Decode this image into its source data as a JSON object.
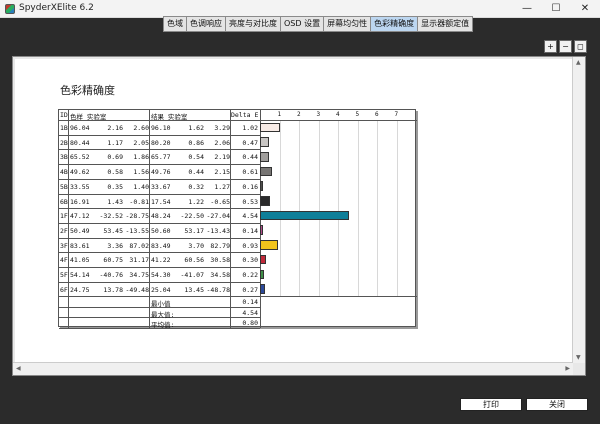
{
  "window": {
    "title": "SpyderXElite 6.2",
    "min": "—",
    "max": "☐",
    "close": "✕"
  },
  "tabs": [
    {
      "label": "色域",
      "active": false
    },
    {
      "label": "色调响应",
      "active": false
    },
    {
      "label": "亮度与对比度",
      "active": false
    },
    {
      "label": "OSD 设置",
      "active": false
    },
    {
      "label": "屏幕均匀性",
      "active": false
    },
    {
      "label": "色彩精确度",
      "active": true
    },
    {
      "label": "显示器额定值",
      "active": false
    }
  ],
  "zoom": {
    "zoom_in": "+",
    "zoom_out": "−",
    "zoom_fit": "◻"
  },
  "report": {
    "title": "色彩精确度",
    "headers": {
      "id": "ID",
      "ref": "色样 实验室",
      "res": "结果 实验室",
      "de": "Delta E"
    },
    "ticks": [
      "1",
      "2",
      "3",
      "4",
      "5",
      "6",
      "7"
    ],
    "rows": [
      {
        "id": "1B",
        "ref": [
          "96.04",
          "2.16",
          "2.60"
        ],
        "res": [
          "96.10",
          "1.62",
          "3.29"
        ],
        "de": "1.02",
        "de_value": 1.02,
        "color": "#f7ebe6"
      },
      {
        "id": "2B",
        "ref": [
          "80.44",
          "1.17",
          "2.05"
        ],
        "res": [
          "80.20",
          "0.86",
          "2.06"
        ],
        "de": "0.47",
        "de_value": 0.47,
        "color": "#c8c5c3"
      },
      {
        "id": "3B",
        "ref": [
          "65.52",
          "0.69",
          "1.86"
        ],
        "res": [
          "65.77",
          "0.54",
          "2.19"
        ],
        "de": "0.44",
        "de_value": 0.44,
        "color": "#a09e9c"
      },
      {
        "id": "4B",
        "ref": [
          "49.62",
          "0.58",
          "1.56"
        ],
        "res": [
          "49.76",
          "0.44",
          "2.15"
        ],
        "de": "0.61",
        "de_value": 0.61,
        "color": "#777573"
      },
      {
        "id": "5B",
        "ref": [
          "33.55",
          "0.35",
          "1.40"
        ],
        "res": [
          "33.67",
          "0.32",
          "1.27"
        ],
        "de": "0.16",
        "de_value": 0.16,
        "color": "#4f4e4d"
      },
      {
        "id": "6B",
        "ref": [
          "16.91",
          "1.43",
          "-0.81"
        ],
        "res": [
          "17.54",
          "1.22",
          "-0.65"
        ],
        "de": "0.53",
        "de_value": 0.53,
        "color": "#2a2a2b"
      },
      {
        "id": "1F",
        "ref": [
          "47.12",
          "-32.52",
          "-28.75"
        ],
        "res": [
          "48.24",
          "-22.50",
          "-27.04"
        ],
        "de": "4.54",
        "de_value": 4.54,
        "color": "#0f7f99"
      },
      {
        "id": "2F",
        "ref": [
          "50.49",
          "53.45",
          "-13.55"
        ],
        "res": [
          "50.60",
          "53.17",
          "-13.43"
        ],
        "de": "0.14",
        "de_value": 0.14,
        "color": "#b14a8a"
      },
      {
        "id": "3F",
        "ref": [
          "83.61",
          "3.36",
          "87.02"
        ],
        "res": [
          "83.49",
          "3.70",
          "82.79"
        ],
        "de": "0.93",
        "de_value": 0.93,
        "color": "#f2c41c"
      },
      {
        "id": "4F",
        "ref": [
          "41.05",
          "60.75",
          "31.17"
        ],
        "res": [
          "41.22",
          "60.56",
          "30.58"
        ],
        "de": "0.30",
        "de_value": 0.3,
        "color": "#c02a3a"
      },
      {
        "id": "5F",
        "ref": [
          "54.14",
          "-40.76",
          "34.75"
        ],
        "res": [
          "54.30",
          "-41.07",
          "34.58"
        ],
        "de": "0.22",
        "de_value": 0.22,
        "color": "#3f8f48"
      },
      {
        "id": "6F",
        "ref": [
          "24.75",
          "13.78",
          "-49.48"
        ],
        "res": [
          "25.04",
          "13.45",
          "-48.78"
        ],
        "de": "0.27",
        "de_value": 0.27,
        "color": "#2c4a9a"
      }
    ],
    "summary": [
      {
        "label": "最小值",
        "value": "0.14"
      },
      {
        "label": "最大值:",
        "value": "4.54"
      },
      {
        "label": "平均值:",
        "value": "0.80"
      }
    ]
  },
  "buttons": {
    "print": "打印",
    "close": "关闭"
  }
}
